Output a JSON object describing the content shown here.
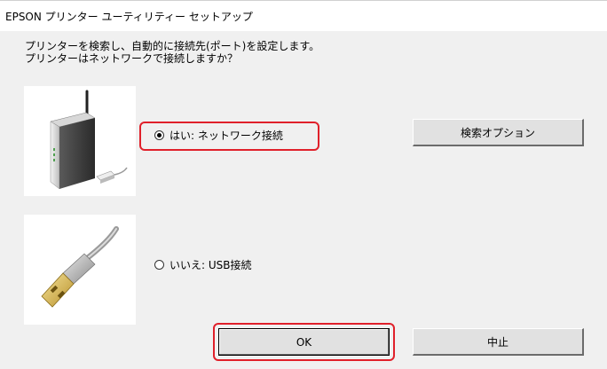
{
  "window": {
    "title": "EPSON プリンター ユーティリティー セットアップ"
  },
  "instruction": {
    "line1": "プリンターを検索し、自動的に接続先(ポート)を設定します。",
    "line2": "プリンターはネットワークで接続しますか？"
  },
  "options": {
    "network": {
      "label": "はい: ネットワーク接続",
      "selected": true
    },
    "usb": {
      "label": "いいえ: USB接続",
      "selected": false
    }
  },
  "buttons": {
    "search_options": "検索オプション",
    "ok": "OK",
    "cancel": "中止"
  },
  "icons": {
    "network": "network-printer-icon",
    "usb": "usb-cable-icon"
  },
  "colors": {
    "highlight": "#e0202a"
  }
}
